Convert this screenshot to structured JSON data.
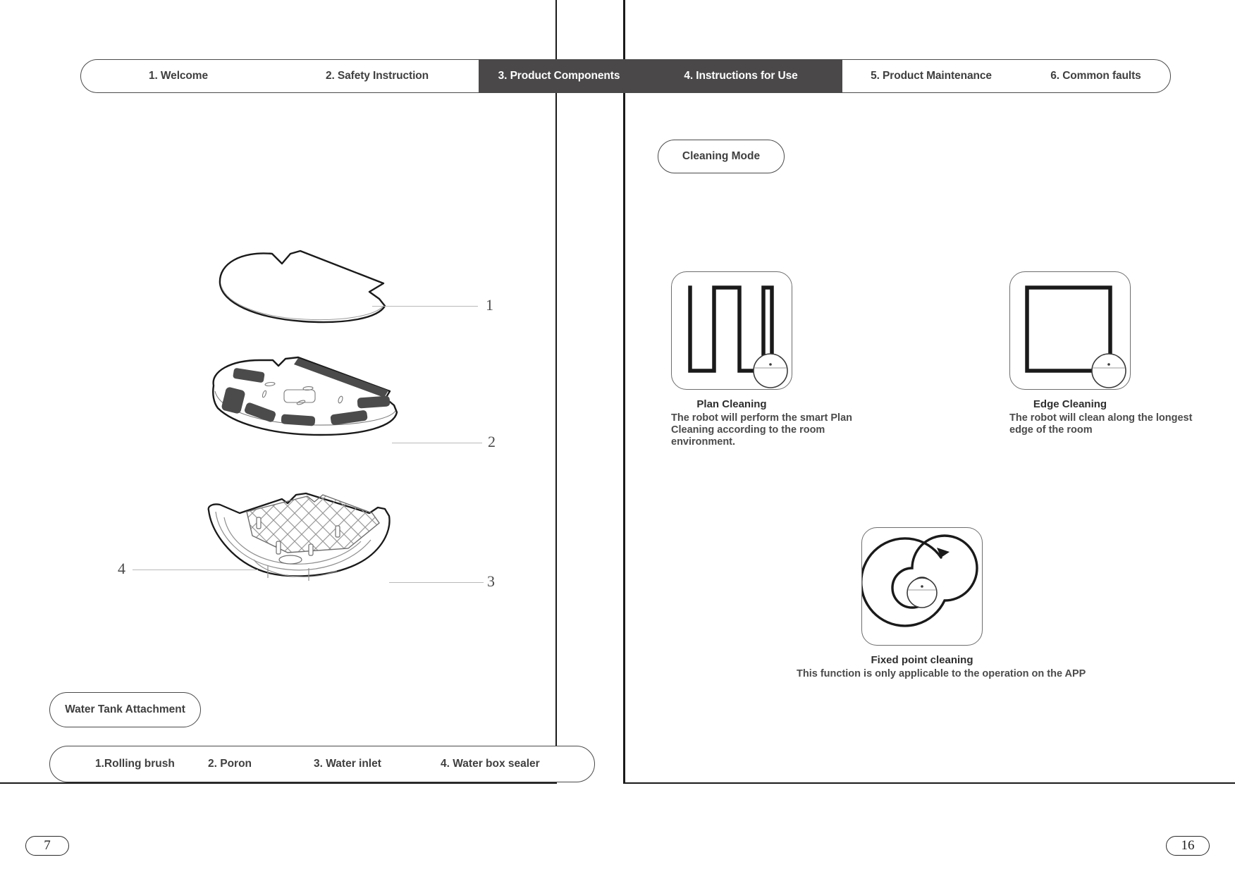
{
  "tabs": [
    {
      "label": "1. Welcome",
      "active": false
    },
    {
      "label": "2. Safety Instruction",
      "active": false
    },
    {
      "label": "3. Product Components",
      "active": true
    },
    {
      "label": "4. Instructions for Use",
      "active": true
    },
    {
      "label": "5. Product Maintenance",
      "active": false
    },
    {
      "label": "6. Common faults",
      "active": false
    }
  ],
  "left_page": {
    "section_pill": "Water Tank Attachment",
    "callouts": [
      "1",
      "2",
      "3",
      "4"
    ],
    "legend": [
      "1.Rolling brush",
      "2. Poron",
      "3. Water inlet",
      "4. Water box sealer"
    ],
    "page_number": "7"
  },
  "right_page": {
    "section_pill": "Cleaning Mode",
    "modes": [
      {
        "icon": "plan-cleaning-zigzag-icon",
        "title": "Plan Cleaning",
        "desc": "The robot will perform the smart Plan Cleaning according to the room environment."
      },
      {
        "icon": "edge-cleaning-perimeter-icon",
        "title": "Edge Cleaning",
        "desc": "The robot will clean along the longest edge of the room"
      },
      {
        "icon": "fixed-point-spiral-icon",
        "title": "Fixed point cleaning",
        "desc": "This function is only applicable to the operation on the APP"
      }
    ],
    "page_number": "16"
  },
  "colors": {
    "active_tab_bg": "#4a4848",
    "active_tab_text": "#ffffff",
    "outline": "#4a4a4a",
    "text": "#3f3f3f",
    "leader_line": "#b9b9b9",
    "drawing_stroke": "#1a1a1a",
    "pad_fill": "#4b4b4b"
  }
}
